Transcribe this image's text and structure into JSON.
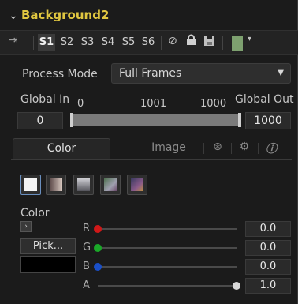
{
  "header": {
    "title": "Background2"
  },
  "toolbar": {
    "versions": [
      "S1",
      "S2",
      "S3",
      "S4",
      "S5",
      "S6"
    ],
    "active_version": "S1",
    "icons": [
      "pin-icon",
      "disable-icon",
      "lock-icon",
      "save-icon"
    ],
    "swatch_color": "#7da06f"
  },
  "process_mode": {
    "label": "Process Mode",
    "value": "Full Frames"
  },
  "global_range": {
    "in_label": "Global In",
    "out_label": "Global Out",
    "in_value": "0",
    "out_value": "1000",
    "tick_start": "0",
    "tick_mid": "1001",
    "tick_end": "1000"
  },
  "tabs": {
    "color": "Color",
    "image": "Image",
    "active": "Color",
    "icons": [
      "nodes-icon",
      "gear-icon",
      "info-icon"
    ]
  },
  "gradient_types": [
    "solid",
    "horizontal",
    "vertical",
    "four-corner",
    "custom"
  ],
  "color": {
    "label": "Color",
    "pick_label": "Pick...",
    "preview_color": "#000000",
    "channels": [
      {
        "label": "R",
        "value": "0.0",
        "dot_color": "#d01818",
        "level": 0.0
      },
      {
        "label": "G",
        "value": "0.0",
        "dot_color": "#1aa828",
        "level": 0.0
      },
      {
        "label": "B",
        "value": "0.0",
        "dot_color": "#1a4fc8",
        "level": 0.0
      },
      {
        "label": "A",
        "value": "1.0",
        "dot_color": "#d8d8d8",
        "level": 1.0
      }
    ]
  }
}
